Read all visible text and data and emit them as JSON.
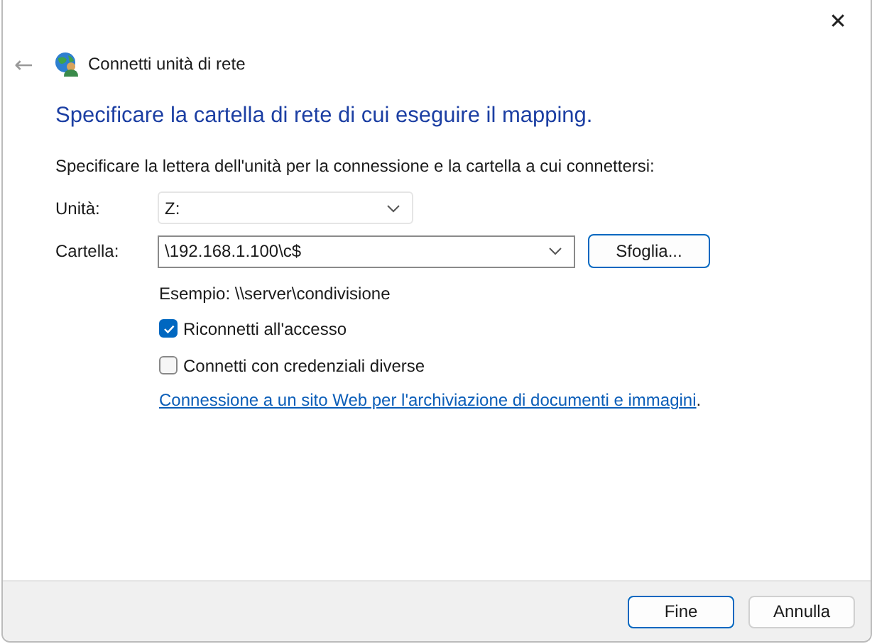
{
  "window": {
    "title": "Connetti unità di rete",
    "close": "✕",
    "back": "←"
  },
  "heading": "Specificare la cartella di rete di cui eseguire il mapping.",
  "instruction": "Specificare la lettera dell'unità per la connessione e la cartella a cui connettersi:",
  "drive": {
    "label": "Unità:",
    "value": "Z:"
  },
  "folder": {
    "label": "Cartella:",
    "value": "\\192.168.1.100\\c$",
    "browse": "Sfoglia..."
  },
  "example": "Esempio: \\\\server\\condivisione",
  "options": [
    {
      "label": "Riconnetti all'accesso",
      "checked": true
    },
    {
      "label": "Connetti con credenziali diverse",
      "checked": false
    }
  ],
  "link": {
    "text": "Connessione a un sito Web per l'archiviazione di documenti e immagini",
    "suffix": "."
  },
  "buttons": [
    {
      "label": "Fine",
      "default": true
    },
    {
      "label": "Annulla",
      "default": false
    }
  ]
}
